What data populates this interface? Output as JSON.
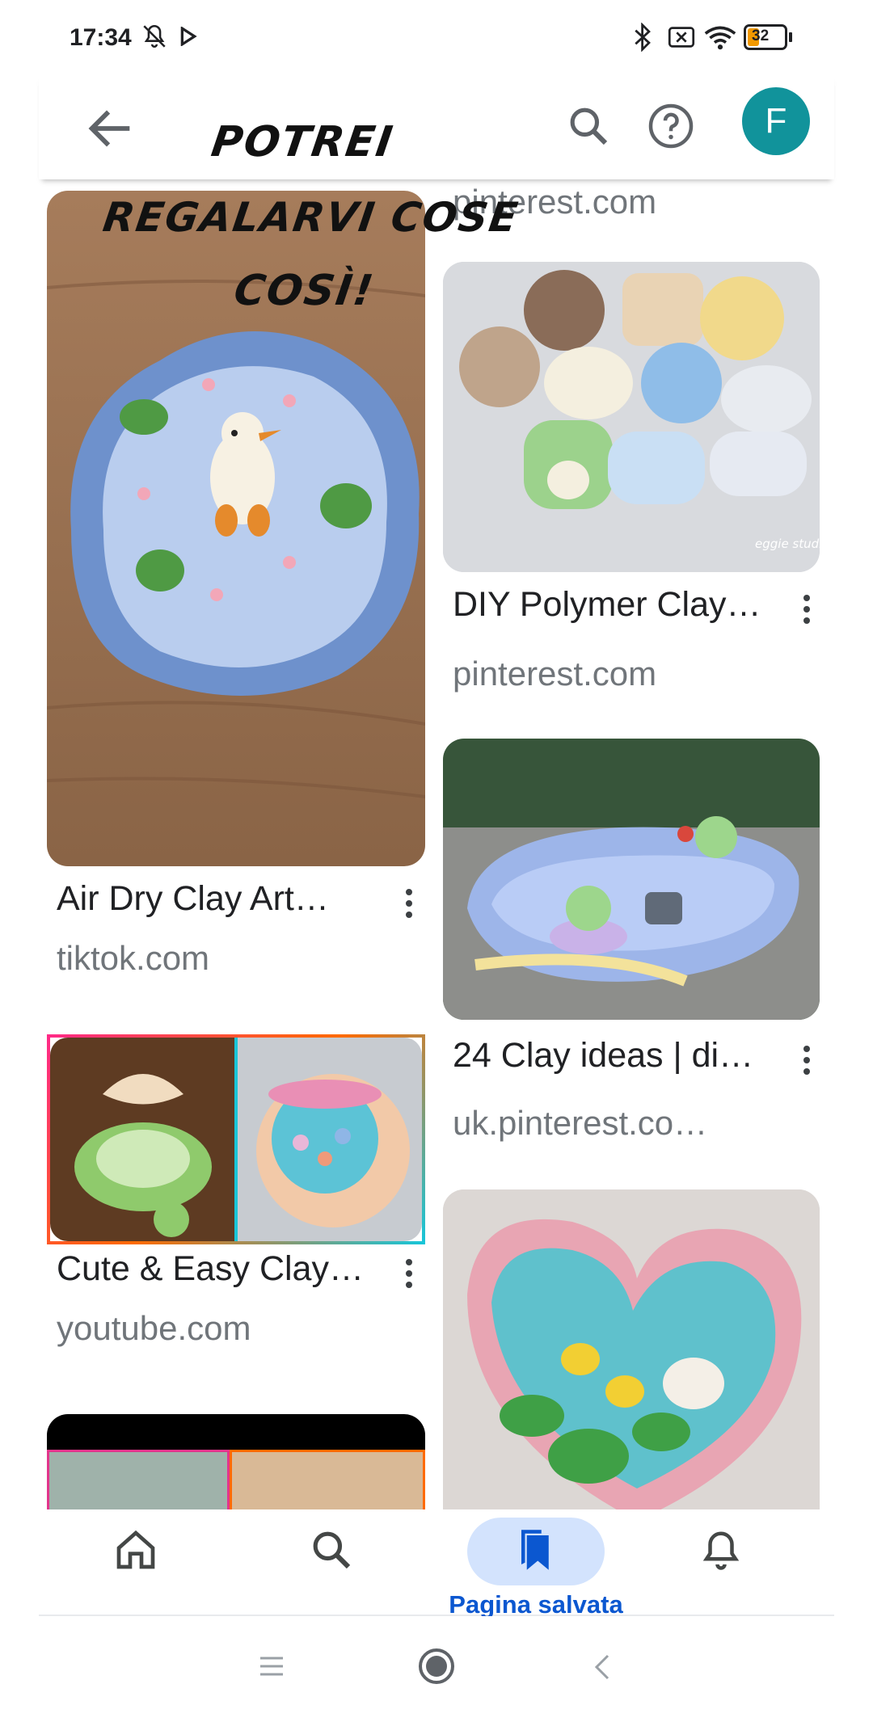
{
  "status_bar": {
    "time": "17:34",
    "battery": "32",
    "icons": [
      "bell-off-icon",
      "play-icon",
      "bluetooth-icon",
      "sim-off-icon",
      "wifi-icon",
      "battery-icon"
    ]
  },
  "app_bar": {
    "back_icon": "arrow-left-icon",
    "search_icon": "search-icon",
    "help_icon": "help-circle-icon",
    "avatar_letter": "F",
    "avatar_color": "#11939b"
  },
  "overlay_text": {
    "line1": "POTREI",
    "line2": "REGALARVI COSE",
    "line3": "COSÌ!"
  },
  "feed": {
    "left": [
      {
        "title": "Air Dry Clay Art…",
        "source": "tiktok.com"
      },
      {
        "title": "Cute & Easy Clay…",
        "source": "youtube.com"
      }
    ],
    "right": [
      {
        "source": "pinterest.com"
      },
      {
        "title": "DIY Polymer Clay…",
        "source": "pinterest.com",
        "watermark": "eggie studio."
      },
      {
        "title": "24 Clay ideas | di…",
        "source": "uk.pinterest.co…"
      }
    ]
  },
  "bottom_nav": {
    "items": [
      {
        "icon": "home-icon"
      },
      {
        "icon": "search-icon"
      },
      {
        "icon": "bookmarks-icon",
        "label": "Pagina salvata",
        "active": true
      },
      {
        "icon": "bell-icon"
      }
    ],
    "accent": "#0b57d0",
    "pill_color": "#d3e3fd"
  },
  "system_nav": [
    "menu-icon",
    "home-circle-icon",
    "back-chevron-icon"
  ]
}
